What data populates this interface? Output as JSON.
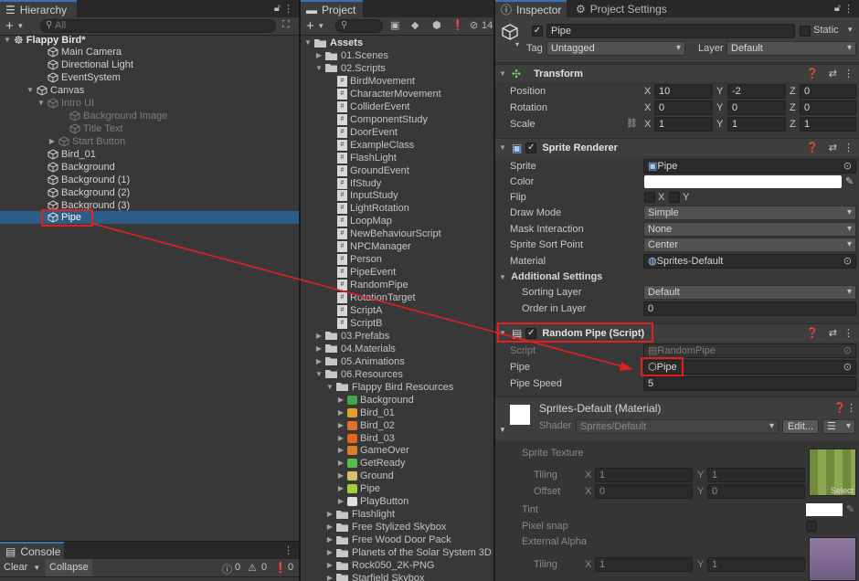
{
  "hierarchy": {
    "tab": "Hierarchy",
    "search_placeholder": "All",
    "scene": "Flappy Bird*",
    "items": [
      {
        "label": "Main Camera",
        "dim": false
      },
      {
        "label": "Directional Light",
        "dim": false
      },
      {
        "label": "EventSystem",
        "dim": false
      },
      {
        "label": "Canvas",
        "dim": false
      },
      {
        "label": "Intro UI",
        "dim": true
      },
      {
        "label": "Background Image",
        "dim": true
      },
      {
        "label": "Title Text",
        "dim": true
      },
      {
        "label": "Start Button",
        "dim": true
      },
      {
        "label": "Bird_01",
        "dim": false
      },
      {
        "label": "Background",
        "dim": false
      },
      {
        "label": "Background (1)",
        "dim": false
      },
      {
        "label": "Background (2)",
        "dim": false
      },
      {
        "label": "Background (3)",
        "dim": false
      },
      {
        "label": "Pipe",
        "dim": false
      }
    ]
  },
  "project": {
    "tab": "Project",
    "count": "14",
    "assets": "Assets",
    "folders": [
      "01.Scenes",
      "02.Scripts"
    ],
    "scripts": [
      "BirdMovement",
      "CharacterMovement",
      "ColliderEvent",
      "ComponentStudy",
      "DoorEvent",
      "ExampleClass",
      "FlashLight",
      "GroundEvent",
      "IfStudy",
      "InputStudy",
      "LightRotation",
      "LoopMap",
      "NewBehaviourScript",
      "NPCManager",
      "Person",
      "PipeEvent",
      "RandomPipe",
      "RotationTarget",
      "ScriptA",
      "ScriptB"
    ],
    "folders2": [
      "03.Prefabs",
      "04.Materials",
      "05.Animations",
      "06.Resources"
    ],
    "resources_folder": "Flappy Bird Resources",
    "resources": [
      "Background",
      "Bird_01",
      "Bird_02",
      "Bird_03",
      "GameOver",
      "GetReady",
      "Ground",
      "Pipe",
      "PlayButton"
    ],
    "folders3": [
      "Flashlight",
      "Free Stylized Skybox",
      "Free Wood Door Pack",
      "Planets of the Solar System 3D",
      "Rock050_2K-PNG",
      "Starfield Skybox"
    ]
  },
  "console": {
    "tab": "Console",
    "clear": "Clear",
    "collapse": "Collapse",
    "logs": "0",
    "warnings": "0",
    "errors": "0"
  },
  "inspector": {
    "tab": "Inspector",
    "tab2": "Project Settings",
    "name": "Pipe",
    "static": "Static",
    "tag_label": "Tag",
    "tag": "Untagged",
    "layer_label": "Layer",
    "layer": "Default",
    "transform": {
      "title": "Transform",
      "position_label": "Position",
      "rotation_label": "Rotation",
      "scale_label": "Scale",
      "axis_x": "X",
      "axis_y": "Y",
      "axis_z": "Z",
      "position": [
        "10",
        "-2",
        "0"
      ],
      "rotation": [
        "0",
        "0",
        "0"
      ],
      "scale": [
        "1",
        "1",
        "1"
      ]
    },
    "sprite_renderer": {
      "title": "Sprite Renderer",
      "sprite_label": "Sprite",
      "sprite": "Pipe",
      "color_label": "Color",
      "flip_label": "Flip",
      "flip_x": "X",
      "flip_y": "Y",
      "draw_mode_label": "Draw Mode",
      "draw_mode": "Simple",
      "mask_label": "Mask Interaction",
      "mask": "None",
      "sort_point_label": "Sprite Sort Point",
      "sort_point": "Center",
      "material_label": "Material",
      "material": "Sprites-Default",
      "additional": "Additional Settings",
      "sorting_layer_label": "Sorting Layer",
      "sorting_layer": "Default",
      "order_label": "Order in Layer",
      "order": "0"
    },
    "random_pipe": {
      "title": "Random Pipe (Script)",
      "script_label": "Script",
      "script": "RandomPipe",
      "pipe_label": "Pipe",
      "pipe": "Pipe",
      "speed_label": "Pipe Speed",
      "speed": "5"
    },
    "material": {
      "title": "Sprites-Default (Material)",
      "shader_label": "Shader",
      "shader": "Sprites/Default",
      "edit": "Edit...",
      "texture_label": "Sprite Texture",
      "tiling_label": "Tiling",
      "offset_label": "Offset",
      "tiling": [
        "1",
        "1"
      ],
      "offset": [
        "0",
        "0"
      ],
      "select": "Select",
      "tint_label": "Tint",
      "pixel_snap_label": "Pixel snap",
      "external_alpha_label": "External Alpha",
      "tiling2": [
        "1",
        "1"
      ]
    }
  },
  "colors": {
    "accent": "#2c5d87",
    "highlight": "#e32020",
    "panel": "#383838"
  }
}
